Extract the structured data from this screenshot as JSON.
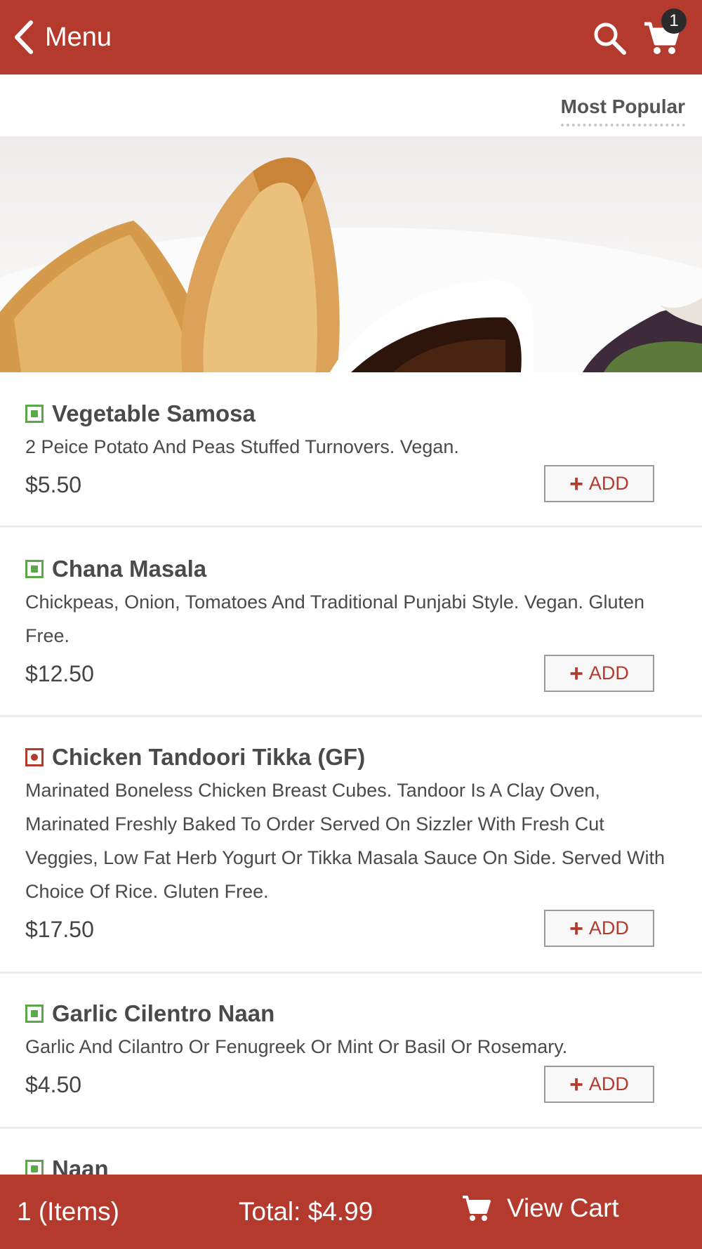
{
  "header": {
    "back_label": "Menu",
    "cart_count": "1",
    "back_icon": "chevron-left-icon",
    "search_icon": "search-icon",
    "cart_icon": "cart-icon"
  },
  "sort": {
    "label": "Most Popular"
  },
  "hero": {
    "image": "samosa-photo"
  },
  "items": [
    {
      "name": "Vegetable Samosa",
      "description": "2 Peice Potato And Peas Stuffed Turnovers. Vegan.",
      "price": "$5.50",
      "type": "veg",
      "add_label": "ADD"
    },
    {
      "name": "Chana Masala",
      "description": "Chickpeas, Onion, Tomatoes And Traditional Punjabi Style. Vegan. Gluten Free.",
      "price": "$12.50",
      "type": "veg",
      "add_label": "ADD"
    },
    {
      "name": "Chicken Tandoori Tikka (GF)",
      "description": "Marinated Boneless Chicken Breast Cubes. Tandoor Is A Clay Oven, Marinated Freshly Baked To Order Served On Sizzler With Fresh Cut Veggies, Low Fat Herb Yogurt Or Tikka Masala Sauce On Side. Served With Choice Of Rice. Gluten Free.",
      "price": "$17.50",
      "type": "non-veg",
      "add_label": "ADD"
    },
    {
      "name": "Garlic Cilentro Naan",
      "description": "Garlic And Cilantro Or Fenugreek Or Mint Or Basil Or Rosemary.",
      "price": "$4.50",
      "type": "veg",
      "add_label": "ADD"
    },
    {
      "name": "Naan",
      "type": "veg"
    }
  ],
  "footer": {
    "items_label": "1 (Items)",
    "total_label": "Total: $4.99",
    "view_cart_label": "View Cart"
  },
  "colors": {
    "brand": "#b43a2d",
    "veg": "#5aa84a",
    "non_veg": "#b43a2d"
  }
}
